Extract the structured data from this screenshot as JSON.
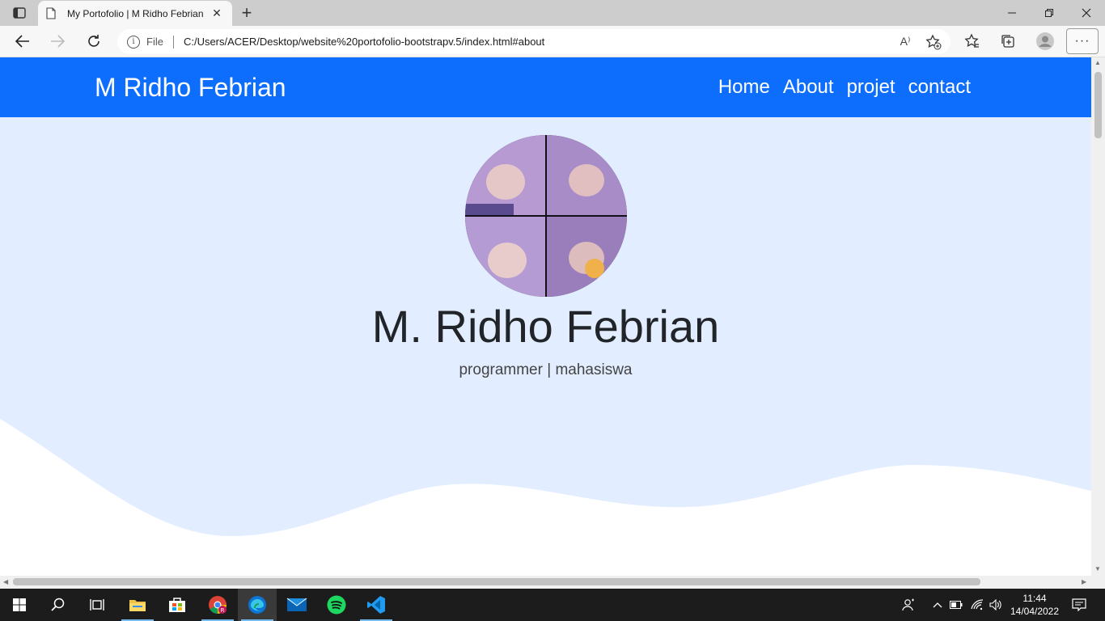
{
  "browser": {
    "tab_title": "My Portofolio | M Ridho Febrian",
    "tab_close": "✕",
    "new_tab": "+",
    "address_prefix": "File",
    "url": "C:/Users/ACER/Desktop/website%20portofolio-bootstrapv.5/index.html#about",
    "more_label": "···",
    "read_aloud_label": "A⁾"
  },
  "page": {
    "brand": "M Ridho Febrian",
    "nav": [
      "Home",
      "About",
      "projet",
      "contact"
    ],
    "hero_name": "M. Ridho Febrian",
    "hero_subtitle": "programmer | mahasiswa"
  },
  "taskbar": {
    "time": "11:44",
    "date": "14/04/2022",
    "apps": [
      "start-icon",
      "search-icon",
      "task-view-icon",
      "file-explorer-icon",
      "store-icon",
      "chrome-icon",
      "edge-icon",
      "mail-icon",
      "spotify-icon",
      "vscode-icon"
    ]
  },
  "colors": {
    "navbar": "#0d6efd",
    "hero_bg": "#e2edff",
    "taskbar": "#1c1c1c"
  }
}
